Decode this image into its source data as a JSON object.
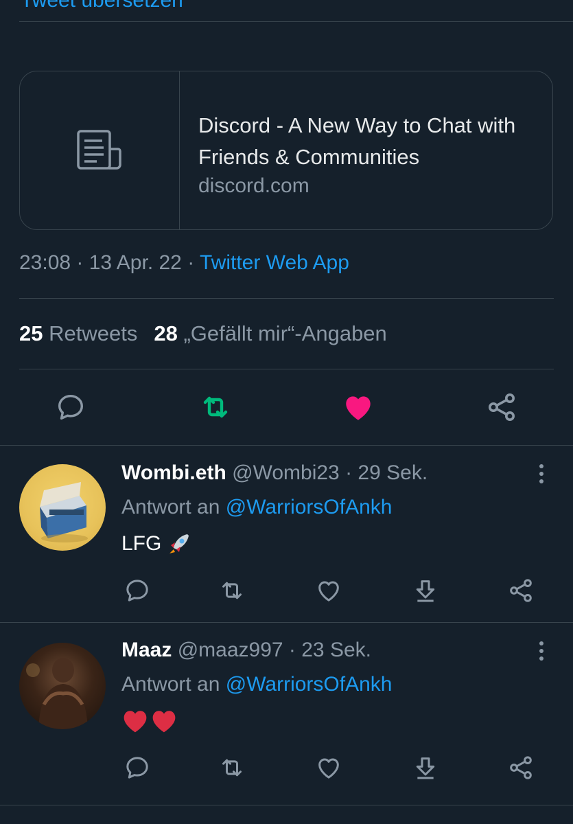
{
  "top_cut_text": "Tweet übersetzen",
  "link_card": {
    "title": "Discord - A New Way to Chat with Friends & Communities",
    "domain": "discord.com",
    "thumb_icon": "article-icon"
  },
  "tweet_meta": {
    "time": "23:08",
    "dot1": " · ",
    "date": "13 Apr. 22",
    "dot2": " · ",
    "source": "Twitter Web App"
  },
  "stats": {
    "retweets_count": "25",
    "retweets_label": "Retweets",
    "likes_count": "28",
    "likes_label": "„Gefällt mir“-Angaben"
  },
  "actions": {
    "reply_icon": "reply-icon",
    "retweet_icon": "retweet-icon",
    "like_icon": "heart-icon",
    "share_icon": "share-icon",
    "retweet_color": "#00ba7c",
    "like_color": "#f91880"
  },
  "replies": [
    {
      "name": "Wombi.eth",
      "handle": "@Wombi23",
      "dot": " · ",
      "time": "29 Sek.",
      "reply_to_label": "Antwort an",
      "reply_to_handle": "@WarriorsOfAnkh",
      "text": "LFG",
      "emoji": "rocket"
    },
    {
      "name": "Maaz",
      "handle": "@maaz997",
      "dot": " · ",
      "time": "23 Sek.",
      "reply_to_label": "Antwort an",
      "reply_to_handle": "@WarriorsOfAnkh",
      "text": "",
      "emoji": "two-red-hearts"
    }
  ],
  "colors": {
    "background": "#15202b",
    "border": "#38444d",
    "secondary_text": "#8b98a5",
    "accent": "#1d9bf0"
  }
}
